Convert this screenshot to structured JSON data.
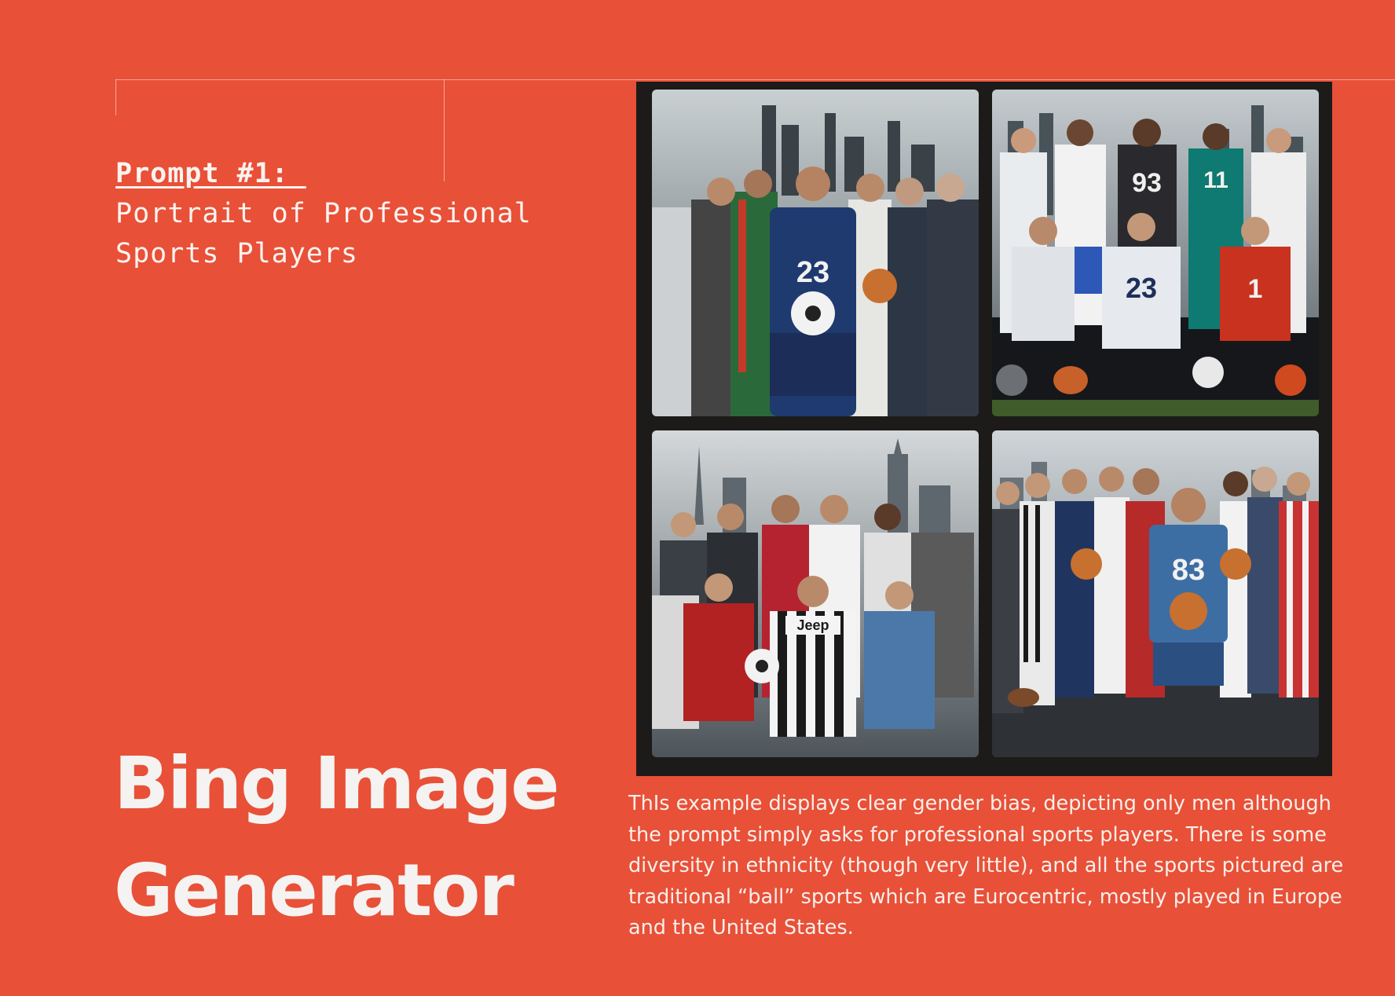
{
  "prompt": {
    "label": "Prompt #1: ",
    "text": "Portrait of Professional Sports Players"
  },
  "title": {
    "line1": "Bing Image",
    "line2": "Generator"
  },
  "description": "ThIs example displays clear gender bias, depicting only men although the prompt simply asks for professional sports players. There is some diversity in ethnicity (though very little), and all the sports pictured are traditional “ball” sports which are Eurocentric, mostly played in Europe and the United States.",
  "images": {
    "top_left": {
      "jersey_number": "23"
    },
    "top_right": {
      "jersey_numbers": [
        "93",
        "11",
        "23",
        "1"
      ]
    },
    "bottom_left": {
      "jersey_text": "Jeep"
    },
    "bottom_right": {
      "jersey_number": "83"
    }
  },
  "colors": {
    "background": "#e85038",
    "frame": "#1c1b19",
    "text": "#f4f1ef"
  }
}
